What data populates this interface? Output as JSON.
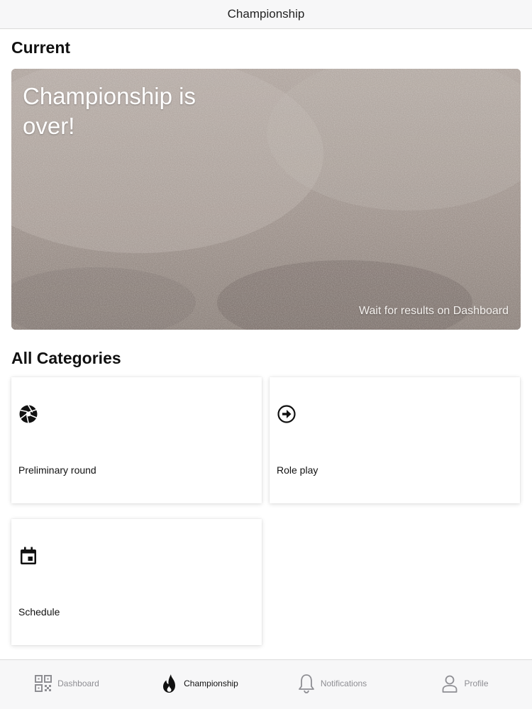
{
  "navbar": {
    "title": "Championship"
  },
  "current": {
    "section_title": "Current",
    "hero": {
      "heading": "Championship is over!",
      "caption": "Wait for results on Dashboard"
    }
  },
  "categories": {
    "section_title": "All Categories",
    "items": [
      {
        "label": "Preliminary round",
        "icon": "camera-aperture-icon"
      },
      {
        "label": "Role play",
        "icon": "arrow-circle-right-icon"
      },
      {
        "label": "Schedule",
        "icon": "calendar-icon"
      }
    ]
  },
  "tabbar": {
    "active": "Championship",
    "items": [
      {
        "label": "Dashboard",
        "icon": "qr-code-icon"
      },
      {
        "label": "Championship",
        "icon": "flame-icon"
      },
      {
        "label": "Notifications",
        "icon": "bell-icon"
      },
      {
        "label": "Profile",
        "icon": "person-icon"
      }
    ]
  },
  "colors": {
    "hero_background": "#a59a94",
    "bar_background": "#f7f7f8",
    "inactive_tab": "#8e8e93"
  }
}
